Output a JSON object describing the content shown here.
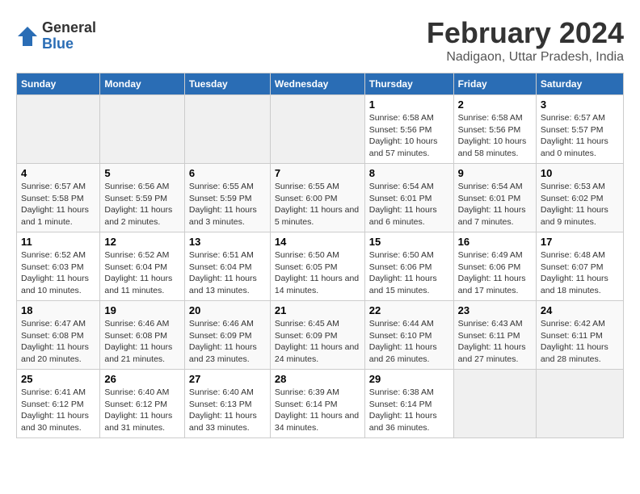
{
  "header": {
    "logo": {
      "general": "General",
      "blue": "Blue"
    },
    "title": "February 2024",
    "subtitle": "Nadigaon, Uttar Pradesh, India"
  },
  "days_of_week": [
    "Sunday",
    "Monday",
    "Tuesday",
    "Wednesday",
    "Thursday",
    "Friday",
    "Saturday"
  ],
  "weeks": [
    [
      {
        "day": "",
        "sunrise": "",
        "sunset": "",
        "daylight": "",
        "empty": true
      },
      {
        "day": "",
        "sunrise": "",
        "sunset": "",
        "daylight": "",
        "empty": true
      },
      {
        "day": "",
        "sunrise": "",
        "sunset": "",
        "daylight": "",
        "empty": true
      },
      {
        "day": "",
        "sunrise": "",
        "sunset": "",
        "daylight": "",
        "empty": true
      },
      {
        "day": "1",
        "sunrise": "Sunrise: 6:58 AM",
        "sunset": "Sunset: 5:56 PM",
        "daylight": "Daylight: 10 hours and 57 minutes.",
        "empty": false
      },
      {
        "day": "2",
        "sunrise": "Sunrise: 6:58 AM",
        "sunset": "Sunset: 5:56 PM",
        "daylight": "Daylight: 10 hours and 58 minutes.",
        "empty": false
      },
      {
        "day": "3",
        "sunrise": "Sunrise: 6:57 AM",
        "sunset": "Sunset: 5:57 PM",
        "daylight": "Daylight: 11 hours and 0 minutes.",
        "empty": false
      }
    ],
    [
      {
        "day": "4",
        "sunrise": "Sunrise: 6:57 AM",
        "sunset": "Sunset: 5:58 PM",
        "daylight": "Daylight: 11 hours and 1 minute.",
        "empty": false
      },
      {
        "day": "5",
        "sunrise": "Sunrise: 6:56 AM",
        "sunset": "Sunset: 5:59 PM",
        "daylight": "Daylight: 11 hours and 2 minutes.",
        "empty": false
      },
      {
        "day": "6",
        "sunrise": "Sunrise: 6:55 AM",
        "sunset": "Sunset: 5:59 PM",
        "daylight": "Daylight: 11 hours and 3 minutes.",
        "empty": false
      },
      {
        "day": "7",
        "sunrise": "Sunrise: 6:55 AM",
        "sunset": "Sunset: 6:00 PM",
        "daylight": "Daylight: 11 hours and 5 minutes.",
        "empty": false
      },
      {
        "day": "8",
        "sunrise": "Sunrise: 6:54 AM",
        "sunset": "Sunset: 6:01 PM",
        "daylight": "Daylight: 11 hours and 6 minutes.",
        "empty": false
      },
      {
        "day": "9",
        "sunrise": "Sunrise: 6:54 AM",
        "sunset": "Sunset: 6:01 PM",
        "daylight": "Daylight: 11 hours and 7 minutes.",
        "empty": false
      },
      {
        "day": "10",
        "sunrise": "Sunrise: 6:53 AM",
        "sunset": "Sunset: 6:02 PM",
        "daylight": "Daylight: 11 hours and 9 minutes.",
        "empty": false
      }
    ],
    [
      {
        "day": "11",
        "sunrise": "Sunrise: 6:52 AM",
        "sunset": "Sunset: 6:03 PM",
        "daylight": "Daylight: 11 hours and 10 minutes.",
        "empty": false
      },
      {
        "day": "12",
        "sunrise": "Sunrise: 6:52 AM",
        "sunset": "Sunset: 6:04 PM",
        "daylight": "Daylight: 11 hours and 11 minutes.",
        "empty": false
      },
      {
        "day": "13",
        "sunrise": "Sunrise: 6:51 AM",
        "sunset": "Sunset: 6:04 PM",
        "daylight": "Daylight: 11 hours and 13 minutes.",
        "empty": false
      },
      {
        "day": "14",
        "sunrise": "Sunrise: 6:50 AM",
        "sunset": "Sunset: 6:05 PM",
        "daylight": "Daylight: 11 hours and 14 minutes.",
        "empty": false
      },
      {
        "day": "15",
        "sunrise": "Sunrise: 6:50 AM",
        "sunset": "Sunset: 6:06 PM",
        "daylight": "Daylight: 11 hours and 15 minutes.",
        "empty": false
      },
      {
        "day": "16",
        "sunrise": "Sunrise: 6:49 AM",
        "sunset": "Sunset: 6:06 PM",
        "daylight": "Daylight: 11 hours and 17 minutes.",
        "empty": false
      },
      {
        "day": "17",
        "sunrise": "Sunrise: 6:48 AM",
        "sunset": "Sunset: 6:07 PM",
        "daylight": "Daylight: 11 hours and 18 minutes.",
        "empty": false
      }
    ],
    [
      {
        "day": "18",
        "sunrise": "Sunrise: 6:47 AM",
        "sunset": "Sunset: 6:08 PM",
        "daylight": "Daylight: 11 hours and 20 minutes.",
        "empty": false
      },
      {
        "day": "19",
        "sunrise": "Sunrise: 6:46 AM",
        "sunset": "Sunset: 6:08 PM",
        "daylight": "Daylight: 11 hours and 21 minutes.",
        "empty": false
      },
      {
        "day": "20",
        "sunrise": "Sunrise: 6:46 AM",
        "sunset": "Sunset: 6:09 PM",
        "daylight": "Daylight: 11 hours and 23 minutes.",
        "empty": false
      },
      {
        "day": "21",
        "sunrise": "Sunrise: 6:45 AM",
        "sunset": "Sunset: 6:09 PM",
        "daylight": "Daylight: 11 hours and 24 minutes.",
        "empty": false
      },
      {
        "day": "22",
        "sunrise": "Sunrise: 6:44 AM",
        "sunset": "Sunset: 6:10 PM",
        "daylight": "Daylight: 11 hours and 26 minutes.",
        "empty": false
      },
      {
        "day": "23",
        "sunrise": "Sunrise: 6:43 AM",
        "sunset": "Sunset: 6:11 PM",
        "daylight": "Daylight: 11 hours and 27 minutes.",
        "empty": false
      },
      {
        "day": "24",
        "sunrise": "Sunrise: 6:42 AM",
        "sunset": "Sunset: 6:11 PM",
        "daylight": "Daylight: 11 hours and 28 minutes.",
        "empty": false
      }
    ],
    [
      {
        "day": "25",
        "sunrise": "Sunrise: 6:41 AM",
        "sunset": "Sunset: 6:12 PM",
        "daylight": "Daylight: 11 hours and 30 minutes.",
        "empty": false
      },
      {
        "day": "26",
        "sunrise": "Sunrise: 6:40 AM",
        "sunset": "Sunset: 6:12 PM",
        "daylight": "Daylight: 11 hours and 31 minutes.",
        "empty": false
      },
      {
        "day": "27",
        "sunrise": "Sunrise: 6:40 AM",
        "sunset": "Sunset: 6:13 PM",
        "daylight": "Daylight: 11 hours and 33 minutes.",
        "empty": false
      },
      {
        "day": "28",
        "sunrise": "Sunrise: 6:39 AM",
        "sunset": "Sunset: 6:14 PM",
        "daylight": "Daylight: 11 hours and 34 minutes.",
        "empty": false
      },
      {
        "day": "29",
        "sunrise": "Sunrise: 6:38 AM",
        "sunset": "Sunset: 6:14 PM",
        "daylight": "Daylight: 11 hours and 36 minutes.",
        "empty": false
      },
      {
        "day": "",
        "sunrise": "",
        "sunset": "",
        "daylight": "",
        "empty": true
      },
      {
        "day": "",
        "sunrise": "",
        "sunset": "",
        "daylight": "",
        "empty": true
      }
    ]
  ]
}
